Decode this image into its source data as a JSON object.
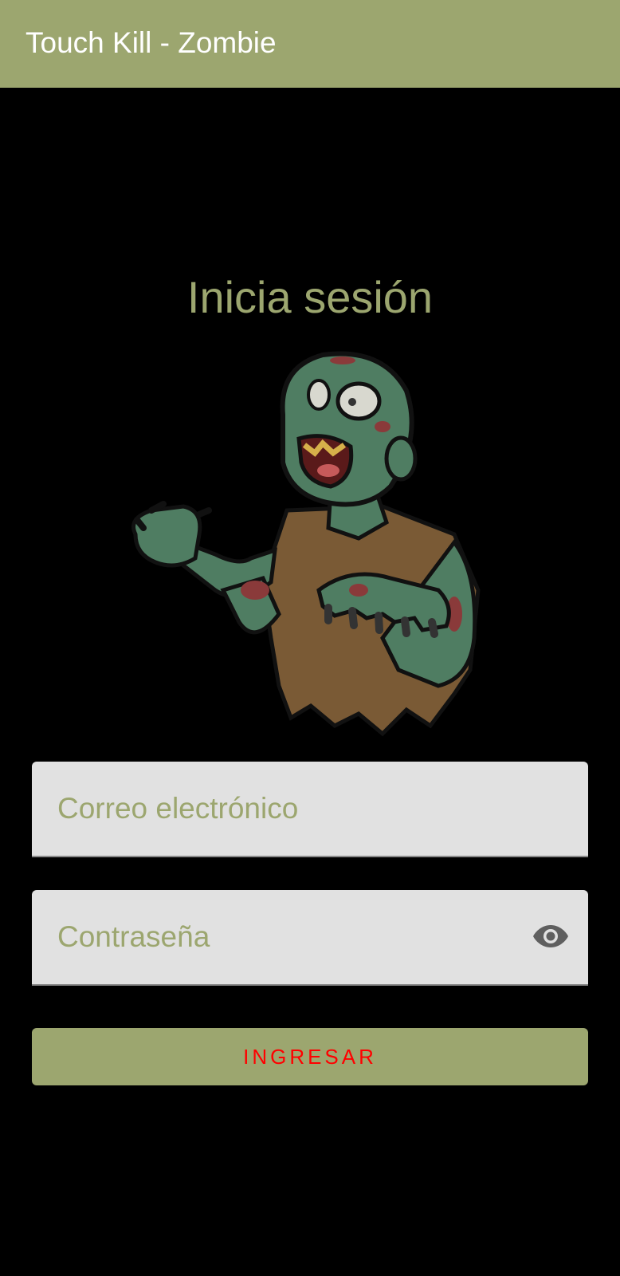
{
  "app_bar": {
    "title": "Touch Kill - Zombie",
    "color": "#9ca66f"
  },
  "login": {
    "heading": "Inicia sesión",
    "illustration_icon": "zombie-illustration",
    "email_field": {
      "placeholder": "Correo electrónico",
      "value": ""
    },
    "password_field": {
      "placeholder": "Contraseña",
      "value": "",
      "toggle_icon": "eye-icon"
    },
    "submit_label": "INGRESAR",
    "submit_label_color": "#ff0000"
  }
}
